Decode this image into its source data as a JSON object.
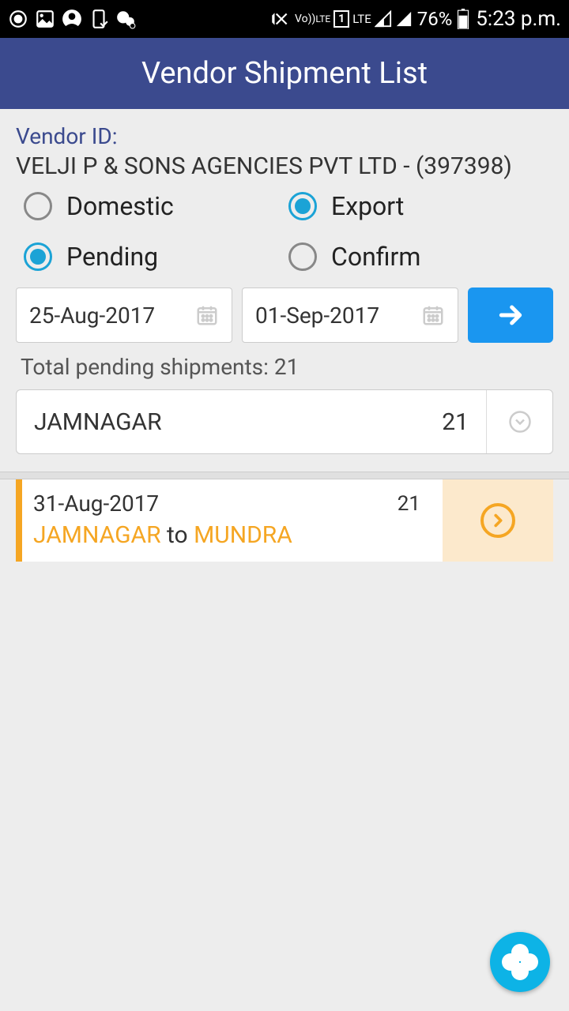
{
  "statusbar": {
    "battery": "76%",
    "time": "5:23 p.m.",
    "lte": "LTE",
    "volte": "Vo))",
    "sim": "1"
  },
  "appbar": {
    "title": "Vendor Shipment List"
  },
  "vendor": {
    "label": "Vendor ID:",
    "name": "VELJI P & SONS AGENCIES PVT LTD - (397398)"
  },
  "filters": {
    "domestic": "Domestic",
    "export": "Export",
    "pending": "Pending",
    "confirm": "Confirm",
    "selected_type": "export",
    "selected_status": "pending"
  },
  "dates": {
    "from": "25-Aug-2017",
    "to": "01-Sep-2017"
  },
  "summary": {
    "total_label": "Total pending shipments: 21",
    "location": "JAMNAGAR",
    "location_count": "21"
  },
  "shipment": {
    "date": "31-Aug-2017",
    "from": "JAMNAGAR",
    "to_word": " to ",
    "to": "MUNDRA",
    "count": "21"
  }
}
